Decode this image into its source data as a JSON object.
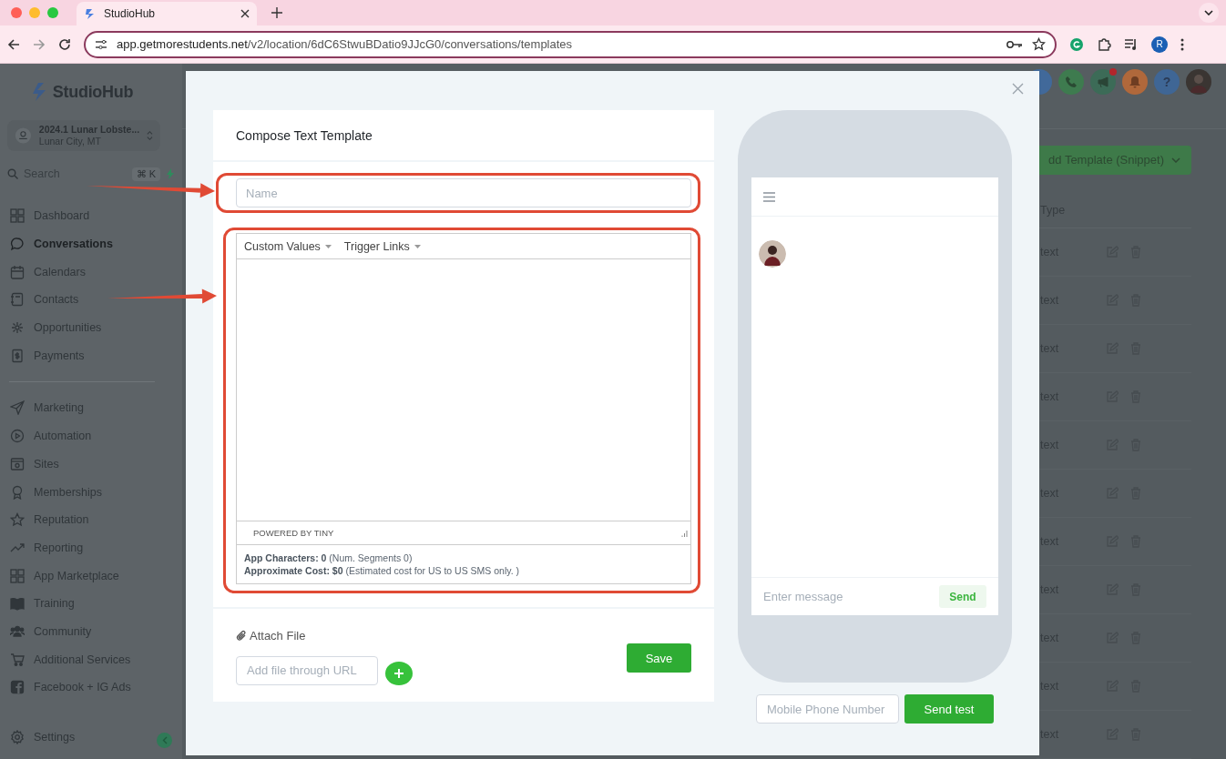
{
  "browser": {
    "tab_title": "StudioHub",
    "url_host": "app.getmorestudents.net",
    "url_path": "/v2/location/6dC6StwuBDatio9JJcG0/conversations/templates",
    "profile_initial": "R"
  },
  "sidebar": {
    "brand": "StudioHub",
    "account": {
      "name": "2024.1 Lunar Lobste...",
      "location": "Lunar City, MT"
    },
    "search": {
      "placeholder": "Search",
      "shortcut": "⌘ K"
    },
    "primary": [
      {
        "label": "Dashboard",
        "kind": "dashboard",
        "selected": false
      },
      {
        "label": "Conversations",
        "kind": "conversations",
        "selected": true
      },
      {
        "label": "Calendars",
        "kind": "calendars",
        "selected": false
      },
      {
        "label": "Contacts",
        "kind": "contacts",
        "selected": false
      },
      {
        "label": "Opportunities",
        "kind": "opportunities",
        "selected": false
      },
      {
        "label": "Payments",
        "kind": "payments",
        "selected": false
      }
    ],
    "secondary": [
      {
        "label": "Marketing",
        "kind": "marketing",
        "selected": false
      },
      {
        "label": "Automation",
        "kind": "automation",
        "selected": false
      },
      {
        "label": "Sites",
        "kind": "sites",
        "selected": false
      },
      {
        "label": "Memberships",
        "kind": "memberships",
        "selected": false
      },
      {
        "label": "Reputation",
        "kind": "reputation",
        "selected": false
      },
      {
        "label": "Reporting",
        "kind": "reporting",
        "selected": false
      },
      {
        "label": "App Marketplace",
        "kind": "marketplace",
        "selected": false
      },
      {
        "label": "Training",
        "kind": "training",
        "selected": false
      },
      {
        "label": "Community",
        "kind": "community",
        "selected": false
      },
      {
        "label": "Additional Services",
        "kind": "services",
        "selected": false
      },
      {
        "label": "Facebook + IG Ads",
        "kind": "facebook",
        "selected": false
      }
    ],
    "settings": {
      "label": "Settings",
      "kind": "settings",
      "selected": false
    }
  },
  "header_icons": [
    {
      "kind": "circle",
      "color": "#41699a",
      "badge": false
    },
    {
      "kind": "phone",
      "color": "#3e7b4f",
      "badge": false
    },
    {
      "kind": "megaphone",
      "color": "#3c6b57",
      "badge": true
    },
    {
      "kind": "bell",
      "color": "#b0683b",
      "badge": false
    },
    {
      "kind": "help",
      "color": "#3f6695",
      "badge": false,
      "label": "?"
    },
    {
      "kind": "avatar",
      "badge": false
    }
  ],
  "templates": {
    "add_button": "dd Template (Snippet)",
    "type_header": "Type",
    "rows": [
      {
        "type": "text"
      },
      {
        "type": "text"
      },
      {
        "type": "text"
      },
      {
        "type": "text"
      },
      {
        "type": "text"
      },
      {
        "type": "text"
      },
      {
        "type": "text"
      },
      {
        "type": "text"
      },
      {
        "type": "text"
      },
      {
        "type": "text"
      },
      {
        "type": "text"
      }
    ]
  },
  "modal": {
    "title": "Compose Text Template",
    "name_placeholder": "Name",
    "menus": [
      "Custom Values",
      "Trigger Links"
    ],
    "powered_by": "POWERED BY TINY",
    "stats": [
      "**App Characters: 0** (Num. Segments 0)",
      "**Approximate Cost: $0** (Estimated cost for US to US SMS only. )"
    ],
    "attach_label": "Attach File",
    "url_placeholder": "Add file through URL",
    "save": "Save",
    "preview": {
      "message_placeholder": "Enter message",
      "send": "Send"
    },
    "phone_placeholder": "Mobile Phone Number",
    "send_test": "Send test"
  },
  "annotations": [
    {
      "kind": "arrow"
    },
    {
      "kind": "arrow"
    }
  ]
}
